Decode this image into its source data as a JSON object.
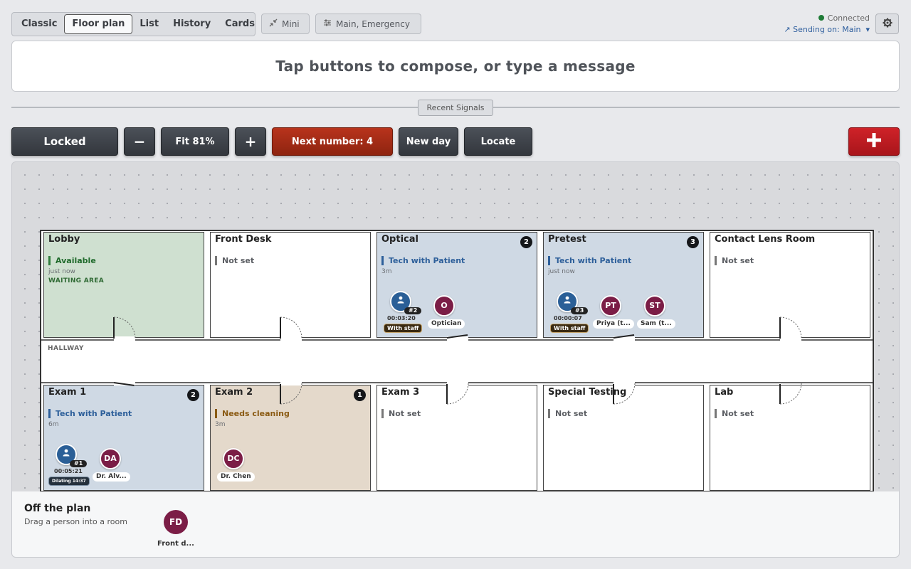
{
  "tabs": [
    "Classic",
    "Floor plan",
    "List",
    "History",
    "Cards"
  ],
  "active_tab": "Floor plan",
  "mini_label": "Mini",
  "channels_label": "Main, Emergency",
  "status": {
    "connected": "Connected",
    "sending": "Sending on: Main"
  },
  "compose_placeholder": "Tap buttons to compose, or type a message",
  "recent_signals_label": "Recent Signals",
  "toolbar": {
    "locked": "Locked",
    "zoom_out": "−",
    "fit": "Fit 81%",
    "zoom_in": "+",
    "next_number": "Next number: 4",
    "new_day": "New day",
    "locate": "Locate"
  },
  "hallway_label": "HALLWAY",
  "rooms": [
    {
      "name": "Lobby",
      "status": "Available",
      "sub": "just now",
      "note": "WAITING AREA",
      "badge": ""
    },
    {
      "name": "Front Desk",
      "status": "Not set",
      "sub": "",
      "note": "",
      "badge": ""
    },
    {
      "name": "Optical",
      "status": "Tech with Patient",
      "sub": "3m",
      "note": "",
      "badge": "2"
    },
    {
      "name": "Pretest",
      "status": "Tech with Patient",
      "sub": "just now",
      "note": "",
      "badge": "3"
    },
    {
      "name": "Contact Lens Room",
      "status": "Not set",
      "sub": "",
      "note": "",
      "badge": ""
    },
    {
      "name": "Exam 1",
      "status": "Tech with Patient",
      "sub": "6m",
      "note": "",
      "badge": "2"
    },
    {
      "name": "Exam 2",
      "status": "Needs cleaning",
      "sub": "3m",
      "note": "",
      "badge": "1"
    },
    {
      "name": "Exam 3",
      "status": "Not set",
      "sub": "",
      "note": "",
      "badge": ""
    },
    {
      "name": "Special Testing",
      "status": "Not set",
      "sub": "",
      "note": "",
      "badge": ""
    },
    {
      "name": "Lab",
      "status": "Not set",
      "sub": "",
      "note": "",
      "badge": ""
    }
  ],
  "people": {
    "optical": {
      "ticket": "#2",
      "timer": "00:03:20",
      "tag": "With staff",
      "staff_initials": "O",
      "staff_label": "Optician"
    },
    "pretest": {
      "ticket": "#3",
      "timer": "00:00:07",
      "tag": "With staff",
      "p1_initials": "PT",
      "p1_label": "Priya (t...",
      "p2_initials": "ST",
      "p2_label": "Sam (t..."
    },
    "exam1": {
      "ticket": "#1",
      "timer": "00:05:21",
      "tag": "Dilating 14:37",
      "staff_initials": "DA",
      "staff_label": "Dr. Alv..."
    },
    "exam2": {
      "staff_initials": "DC",
      "staff_label": "Dr. Chen"
    }
  },
  "offplan": {
    "title": "Off the plan",
    "subtitle": "Drag a person into a room",
    "person_initials": "FD",
    "person_label": "Front d..."
  },
  "colors": {
    "accent_red": "#a9151b",
    "next_number": "#b8331c",
    "available": "#cfe0d0",
    "tech": "#cfd9e4",
    "cleaning": "#e4d9cb",
    "staff_avatar": "#7b1d46",
    "patient_avatar": "#2a5f97"
  }
}
